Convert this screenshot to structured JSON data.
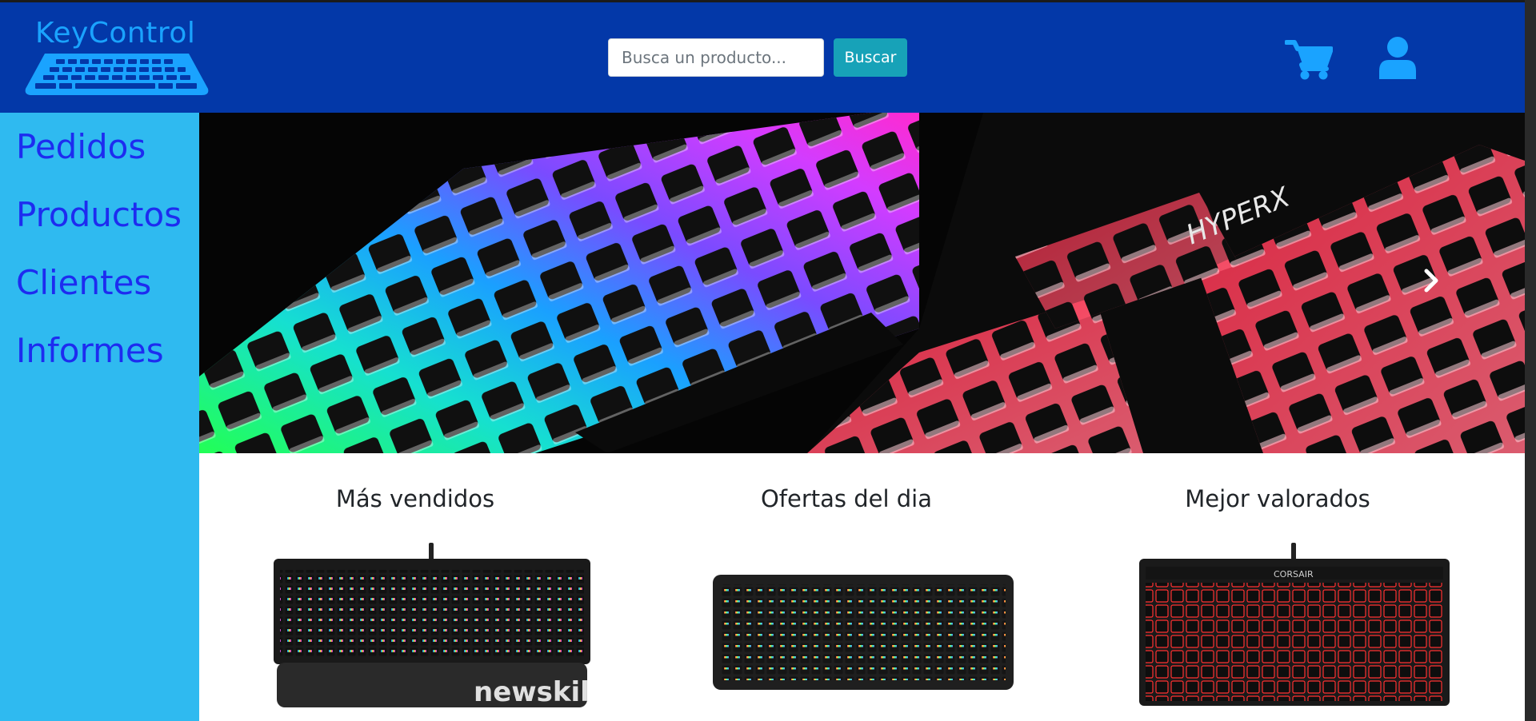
{
  "brand": {
    "name": "KeyControl",
    "color": "#1aa3ff"
  },
  "header": {
    "background": "#0338a8",
    "search": {
      "placeholder": "Busca un producto...",
      "value": "",
      "button_label": "Buscar"
    },
    "icons": {
      "cart": "cart-icon",
      "user": "user-icon"
    }
  },
  "sidebar": {
    "background": "#2fbaf0",
    "items": [
      {
        "label": "Pedidos"
      },
      {
        "label": "Productos"
      },
      {
        "label": "Clientes"
      },
      {
        "label": "Informes"
      }
    ]
  },
  "banner": {
    "image": "rgb-mechanical-keyboard-banner",
    "next_icon": "chevron-right-icon"
  },
  "sections": [
    {
      "title": "Más vendidos",
      "image": "keyboard-with-wrist-rest-rgb"
    },
    {
      "title": "Ofertas del dia",
      "image": "keyboard-black-rgb"
    },
    {
      "title": "Mejor valorados",
      "image": "keyboard-red-backlit-compact"
    }
  ]
}
